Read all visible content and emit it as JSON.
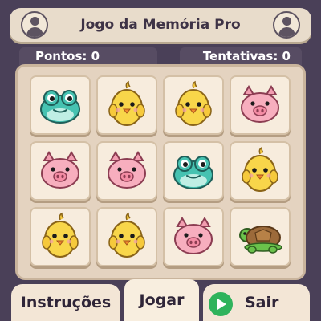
{
  "header": {
    "title": "Jogo da Memória Pro"
  },
  "stats": {
    "score": "Pontos: 0",
    "attempts": "Tentativas: 0"
  },
  "board": {
    "rows": 3,
    "cols": 4,
    "cards": [
      {
        "animal": "frog"
      },
      {
        "animal": "chick"
      },
      {
        "animal": "chick"
      },
      {
        "animal": "pig"
      },
      {
        "animal": "pig"
      },
      {
        "animal": "pig"
      },
      {
        "animal": "frog"
      },
      {
        "animal": "chick"
      },
      {
        "animal": "chick"
      },
      {
        "animal": "chick"
      },
      {
        "animal": "pig"
      },
      {
        "animal": "turtle"
      }
    ]
  },
  "footer": {
    "instructions_label": "Instruções",
    "play_label": "Jogar",
    "exit_label": "Sair"
  },
  "icons": [
    "user-avatar-icon",
    "play-icon",
    "frog-icon",
    "chick-icon",
    "pig-icon",
    "turtle-icon"
  ],
  "colors": {
    "background": "#4a4058",
    "panel": "#e8dccb",
    "card": "#f7ecdd",
    "play_green": "#2fb35c"
  }
}
